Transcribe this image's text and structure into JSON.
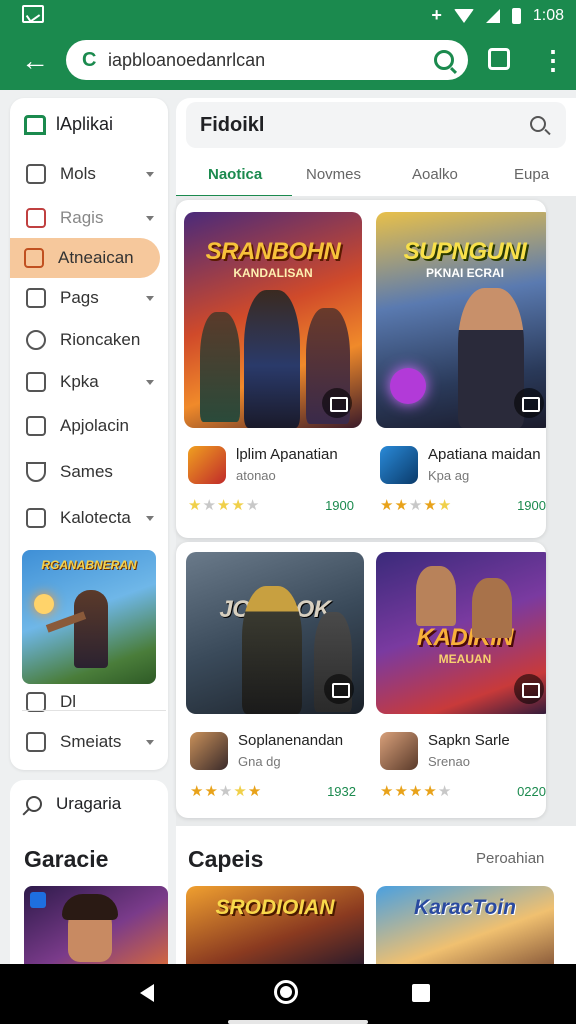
{
  "status": {
    "time": "1:08"
  },
  "browser": {
    "url": "iapbloanoedanrlcan"
  },
  "sidebar": {
    "title": "lAplikai",
    "items": [
      {
        "label": "Mols",
        "chevron": true
      },
      {
        "label": "Ragis",
        "chevron": true
      },
      {
        "label": "Atneaican",
        "chevron": false
      },
      {
        "label": "Pags",
        "chevron": true
      },
      {
        "label": "Rioncaken",
        "chevron": false
      },
      {
        "label": "Kpka",
        "chevron": true
      },
      {
        "label": "Apjolacin",
        "chevron": false
      },
      {
        "label": "Sames",
        "chevron": false
      },
      {
        "label": "Kalotecta",
        "chevron": true
      }
    ],
    "banner_title": "RGANABNERAN",
    "extra_items": [
      {
        "label": "Dl",
        "chevron": false
      },
      {
        "label": "Smeiats",
        "chevron": true
      }
    ],
    "search_label": "Uragaria",
    "section_heading": "Garacie"
  },
  "main": {
    "query": "Fidoikl",
    "tabs": [
      "Naotica",
      "Novmes",
      "Aoalko",
      "Eupa"
    ],
    "cards": [
      {
        "tiles": [
          {
            "art_title": "SRANBOHN",
            "art_sub": "KANDALISAN",
            "name": "lplim Apanatian",
            "sub": "atonao",
            "count": "1900",
            "stars": [
              "half",
              "off",
              "half",
              "half",
              "off"
            ]
          },
          {
            "art_title": "SUPNGUNI",
            "art_sub": "PKNAI ECRAI",
            "name": "Apatiana maidan",
            "sub": "Kpa ag",
            "count": "1900",
            "stars": [
              "on",
              "on",
              "off",
              "on",
              "half"
            ]
          }
        ]
      },
      {
        "tiles": [
          {
            "art_title": "JOYTPOK",
            "art_sub": "",
            "name": "Soplanenandan",
            "sub": "Gna dg",
            "count": "1932",
            "stars": [
              "on",
              "on",
              "off",
              "half",
              "on"
            ]
          },
          {
            "art_title": "KADIKIN",
            "art_sub": "MEAUAN",
            "name": "Sapkn Sarle",
            "sub": "Srenao",
            "count": "0220",
            "stars": [
              "on",
              "on",
              "on",
              "on",
              "off"
            ]
          }
        ]
      }
    ],
    "section": {
      "heading": "Capeis",
      "more": "Peroahian"
    },
    "bottom_tiles": [
      "SRODIOIAN",
      "KaracToin"
    ]
  },
  "colors": {
    "brand": "#1b8a4e",
    "active_bg": "#f6c89c",
    "star": "#e8a21a"
  }
}
